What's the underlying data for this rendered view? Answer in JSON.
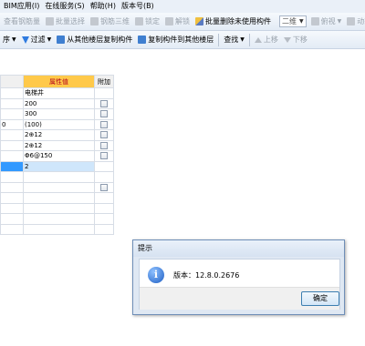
{
  "menubar": {
    "items": [
      "BIM应用(I)",
      "在线服务(S)",
      "帮助(H)",
      "版本号(B)"
    ]
  },
  "toolbar1": {
    "items": [
      "查看钢筋量",
      "批量选择",
      "钢筋三维",
      "锁定",
      "解锁",
      "批量删除未使用构件",
      "俯视",
      "动态观察"
    ],
    "view_combo": "二维"
  },
  "toolbar2": {
    "sort": "序",
    "filter": "过滤",
    "copy_from": "从其他楼层复制构件",
    "copy_to": "复制构件到其他楼层",
    "find": "查找",
    "move_up": "上移",
    "move_down": "下移"
  },
  "grid": {
    "headers": {
      "name": "",
      "value": "属性值",
      "add": "附加"
    },
    "rows": [
      {
        "name": "",
        "value": "电梯井",
        "check": false
      },
      {
        "name": "",
        "value": "200",
        "check": true
      },
      {
        "name": "",
        "value": "300",
        "check": true
      },
      {
        "name": "0",
        "value": "(100)",
        "check": true
      },
      {
        "name": "",
        "value": "2⊕12",
        "check": true
      },
      {
        "name": "",
        "value": "2⊕12",
        "check": true
      },
      {
        "name": "",
        "value": "Φ6@150",
        "check": true
      },
      {
        "name": "",
        "value": "2",
        "check": false,
        "selected": true
      },
      {
        "name": "",
        "value": "",
        "check": false
      },
      {
        "name": "",
        "value": "",
        "check": true
      },
      {
        "name": "",
        "value": "",
        "check": false
      },
      {
        "name": "",
        "value": "",
        "check": false
      },
      {
        "name": "",
        "value": "",
        "check": false
      },
      {
        "name": "",
        "value": "",
        "check": false
      }
    ]
  },
  "dialog": {
    "title": "提示",
    "message": "版本：12.8.0.2676",
    "ok_label": "确定"
  }
}
